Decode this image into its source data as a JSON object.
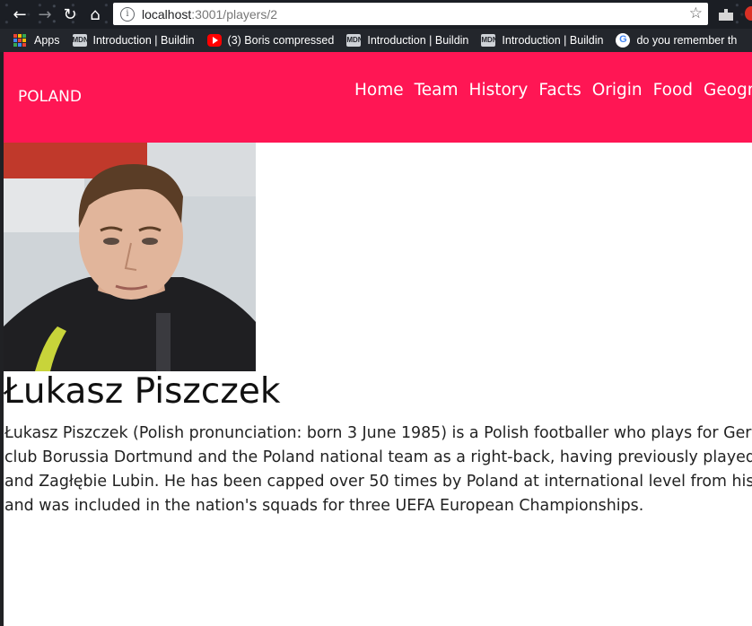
{
  "browser": {
    "url_host": "localhost",
    "url_path": ":3001/players/2",
    "back_glyph": "←",
    "forward_glyph": "→",
    "reload_glyph": "↻",
    "home_glyph": "⌂",
    "star_glyph": "☆",
    "bookmarks": [
      {
        "label": "Apps",
        "icon": "apps-grid-icon"
      },
      {
        "label": "Introduction | Buildin",
        "icon": "mdn-icon"
      },
      {
        "label": "(3) Boris compressed",
        "icon": "youtube-icon"
      },
      {
        "label": "Introduction | Buildin",
        "icon": "mdn-icon"
      },
      {
        "label": "Introduction | Buildin",
        "icon": "mdn-icon"
      },
      {
        "label": "do you remember th",
        "icon": "google-icon"
      }
    ]
  },
  "site": {
    "brand": "POLAND",
    "accent_color": "#ff1654",
    "nav": [
      "Home",
      "Team",
      "History",
      "Facts",
      "Origin",
      "Food",
      "Geogra"
    ]
  },
  "player": {
    "name": "Łukasz Piszczek",
    "bio_lines": [
      "Łukasz Piszczek (Polish pronunciation: born 3 June 1985) is a Polish footballer who plays for German",
      "club Borussia Dortmund and the Poland national team as a right-back, having previously played for",
      "and Zagłębie Lubin. He has been capped over 50 times by Poland at international level from his deb",
      "and was included in the nation's squads for three UEFA European Championships."
    ]
  }
}
